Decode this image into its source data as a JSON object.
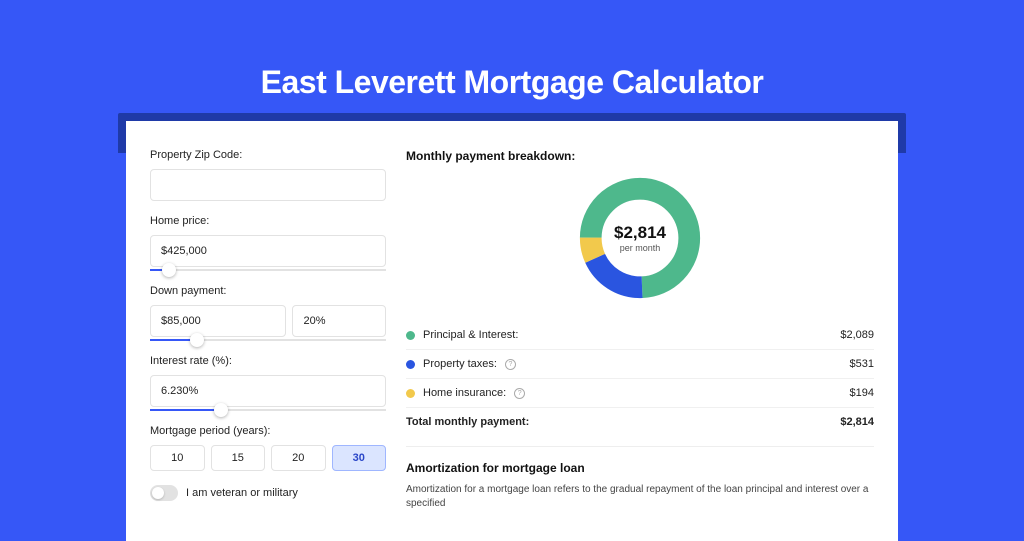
{
  "title": "East Leverett Mortgage Calculator",
  "form": {
    "zip": {
      "label": "Property Zip Code:",
      "value": ""
    },
    "home_price": {
      "label": "Home price:",
      "value": "$425,000",
      "slider_pct": 8
    },
    "down_payment": {
      "label": "Down payment:",
      "amount": "$85,000",
      "pct": "20%",
      "slider_pct": 20
    },
    "interest_rate": {
      "label": "Interest rate (%):",
      "value": "6.230%",
      "slider_pct": 30
    },
    "period": {
      "label": "Mortgage period (years):",
      "options": [
        "10",
        "15",
        "20",
        "30"
      ],
      "active": "30"
    },
    "veteran": {
      "label": "I am veteran or military",
      "on": false
    }
  },
  "breakdown": {
    "title": "Monthly payment breakdown:",
    "donut": {
      "amount": "$2,814",
      "sub": "per month"
    },
    "rows": [
      {
        "label": "Principal & Interest:",
        "value": "$2,089",
        "color": "#4eb88c",
        "info": false
      },
      {
        "label": "Property taxes:",
        "value": "$531",
        "color": "#2a55e0",
        "info": true
      },
      {
        "label": "Home insurance:",
        "value": "$194",
        "color": "#f2c94c",
        "info": true
      }
    ],
    "total": {
      "label": "Total monthly payment:",
      "value": "$2,814"
    }
  },
  "amortization": {
    "title": "Amortization for mortgage loan",
    "text": "Amortization for a mortgage loan refers to the gradual repayment of the loan principal and interest over a specified"
  },
  "chart_data": {
    "type": "pie",
    "title": "Monthly payment breakdown",
    "series": [
      {
        "name": "Principal & Interest",
        "value": 2089,
        "color": "#4eb88c"
      },
      {
        "name": "Property taxes",
        "value": 531,
        "color": "#2a55e0"
      },
      {
        "name": "Home insurance",
        "value": 194,
        "color": "#f2c94c"
      }
    ],
    "total": 2814,
    "center_label": "$2,814 per month"
  }
}
